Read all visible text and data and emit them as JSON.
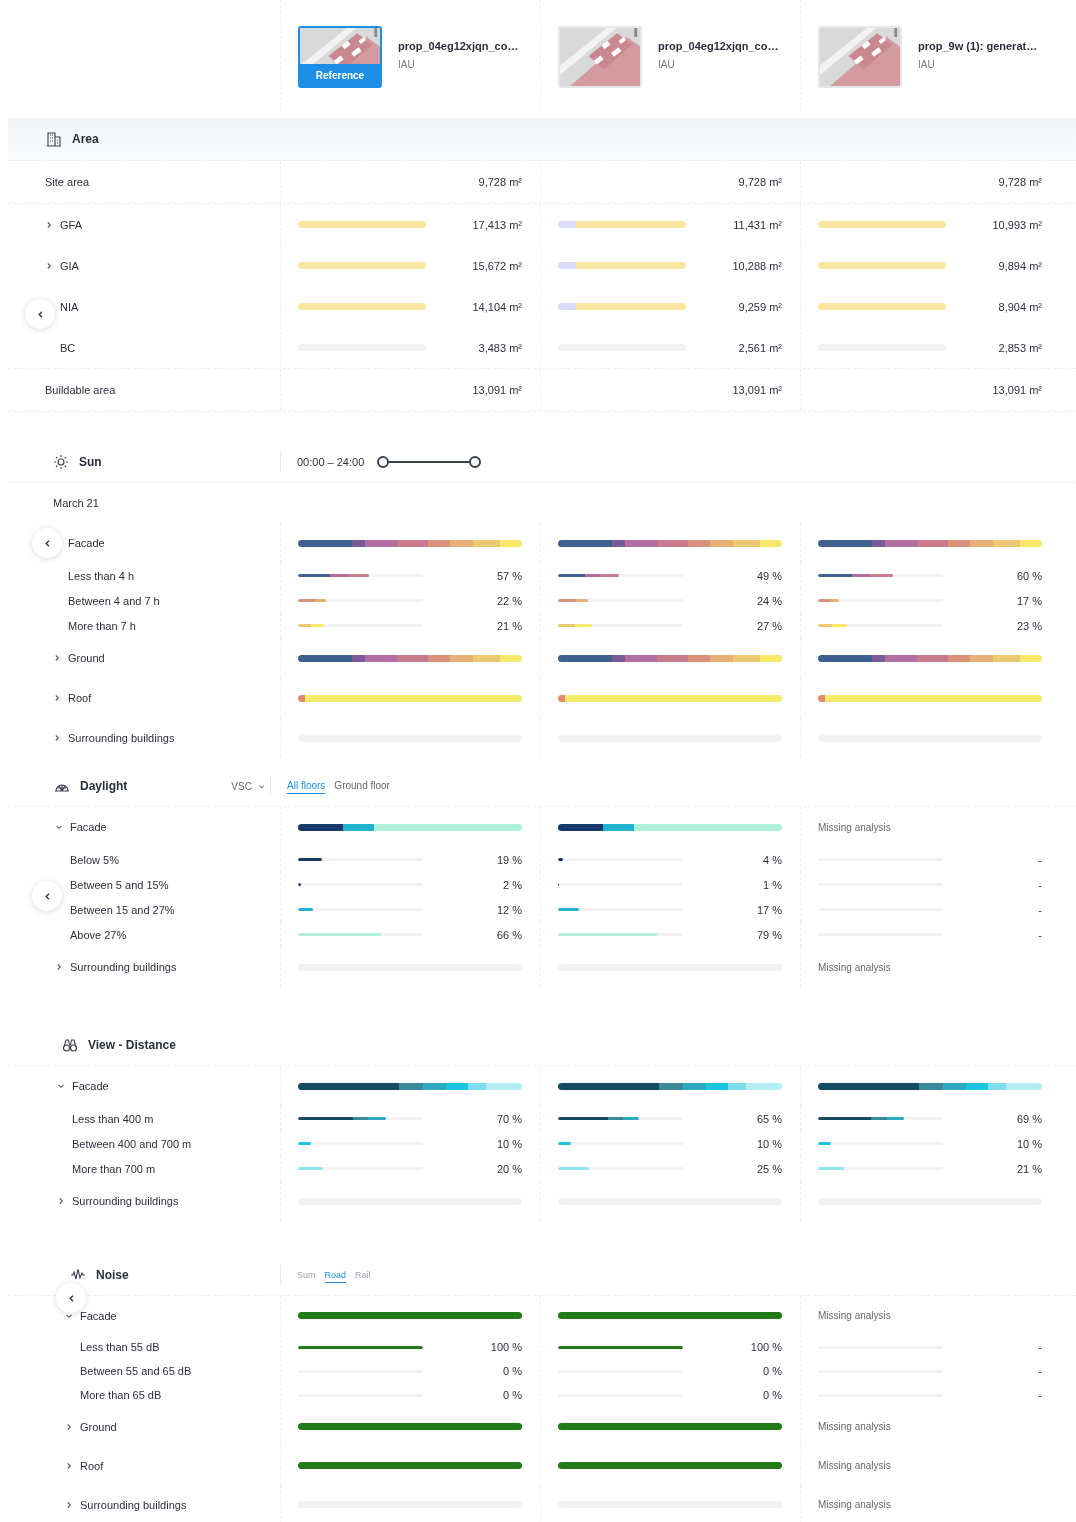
{
  "proposals": [
    {
      "name": "prop_04eg12xjqn_co…",
      "owner": "IAU",
      "reference": true,
      "badge": "Reference"
    },
    {
      "name": "prop_04eg12xjqn_co…",
      "owner": "IAU",
      "reference": false
    },
    {
      "name": "prop_9w (1): generat…",
      "owner": "IAU",
      "reference": false
    }
  ],
  "sections": [
    {
      "kind": "area",
      "title": "Area",
      "rows": [
        {
          "kind": "total",
          "label": "Site area",
          "cells": [
            {
              "kind": "text",
              "value": "9,728 m²"
            },
            {
              "kind": "text",
              "value": "9,728 m²"
            },
            {
              "kind": "text",
              "value": "9,728 m²"
            }
          ]
        },
        {
          "kind": "group",
          "label": "GFA",
          "expanded": false,
          "cells": [
            {
              "kind": "full",
              "value": "17,413 m²"
            },
            {
              "kind": "compare",
              "value": "11,431 m²"
            },
            {
              "kind": "full",
              "value": "10,993 m²"
            }
          ]
        },
        {
          "kind": "group",
          "label": "GIA",
          "expanded": false,
          "cells": [
            {
              "kind": "full",
              "value": "15,672 m²"
            },
            {
              "kind": "compare",
              "value": "10,288 m²"
            },
            {
              "kind": "full",
              "value": "9,894 m²"
            }
          ]
        },
        {
          "kind": "group",
          "label": "NIA",
          "cells": [
            {
              "kind": "full",
              "value": "14,104 m²"
            },
            {
              "kind": "compare",
              "value": "9,259 m²"
            },
            {
              "kind": "full",
              "value": "8,904 m²"
            }
          ]
        },
        {
          "kind": "group",
          "label": "BC",
          "cells": [
            {
              "kind": "empty",
              "value": "3,483 m²"
            },
            {
              "kind": "empty",
              "value": "2,561 m²"
            },
            {
              "kind": "empty",
              "value": "2,853 m²"
            }
          ]
        },
        {
          "kind": "total",
          "label": "Buildable area",
          "cells": [
            {
              "kind": "text",
              "value": "13,091 m²"
            },
            {
              "kind": "text",
              "value": "13,091 m²"
            },
            {
              "kind": "text",
              "value": "13,091 m²"
            }
          ]
        }
      ]
    },
    {
      "kind": "sun",
      "title": "Sun",
      "time_range": "00:00 – 24:00",
      "slider": {
        "level": 1
      },
      "subtitle": "March 21",
      "rows": [
        {
          "kind": "group",
          "label": "Facade",
          "cells": [
            {
              "kind": "spectrum"
            },
            {
              "kind": "spectrum"
            },
            {
              "kind": "spectrum"
            }
          ]
        },
        {
          "kind": "item",
          "label": "Less than 4 h",
          "cells": [
            {
              "kind": "level",
              "level": 0.57,
              "value": "57 %"
            },
            {
              "kind": "level",
              "level": 0.49,
              "value": "49 %"
            },
            {
              "kind": "level",
              "level": 0.6,
              "value": "60 %"
            }
          ]
        },
        {
          "kind": "item",
          "label": "Between 4 and 7 h",
          "cells": [
            {
              "kind": "level",
              "level": 0.22,
              "value": "22 %"
            },
            {
              "kind": "level",
              "level": 0.24,
              "value": "24 %"
            },
            {
              "kind": "level",
              "level": 0.17,
              "value": "17 %"
            }
          ]
        },
        {
          "kind": "item",
          "label": "More than 7 h",
          "cells": [
            {
              "kind": "level",
              "level": 0.21,
              "value": "21 %"
            },
            {
              "kind": "level",
              "level": 0.27,
              "value": "27 %"
            },
            {
              "kind": "level",
              "level": 0.23,
              "value": "23 %"
            }
          ]
        },
        {
          "kind": "group",
          "label": "Ground",
          "expanded": false,
          "cells": [
            {
              "kind": "spectrum"
            },
            {
              "kind": "spectrum"
            },
            {
              "kind": "spectrum"
            }
          ]
        },
        {
          "kind": "group",
          "label": "Roof",
          "expanded": false,
          "cells": [
            {
              "kind": "sunlit"
            },
            {
              "kind": "sunlit"
            },
            {
              "kind": "sunlit"
            }
          ]
        },
        {
          "kind": "group",
          "label": "Surrounding buildings",
          "expanded": false,
          "cells": [
            {
              "kind": "empty"
            },
            {
              "kind": "empty"
            },
            {
              "kind": "empty"
            }
          ]
        }
      ]
    },
    {
      "kind": "daylight",
      "title": "Daylight",
      "dropdown": "VSC",
      "tabs": [
        {
          "label": "All floors",
          "selected": true
        },
        {
          "label": "Ground floor",
          "selected": false
        }
      ],
      "rows": [
        {
          "kind": "group",
          "label": "Facade",
          "expanded": true,
          "cells": [
            {
              "kind": "spectrum"
            },
            {
              "kind": "spectrum"
            },
            {
              "kind": "note",
              "value": "Missing analysis"
            }
          ]
        },
        {
          "kind": "item",
          "label": "Below 5%",
          "cells": [
            {
              "kind": "level",
              "level": 0.19,
              "value": "19 %"
            },
            {
              "kind": "level",
              "level": 0.04,
              "value": "4 %"
            },
            {
              "kind": "level",
              "level": 0,
              "value": "-"
            }
          ]
        },
        {
          "kind": "item",
          "label": "Between 5 and 15%",
          "cells": [
            {
              "kind": "level",
              "level": 0.02,
              "value": "2 %"
            },
            {
              "kind": "level",
              "level": 0.01,
              "value": "1 %"
            },
            {
              "kind": "level",
              "level": 0,
              "value": "-"
            }
          ]
        },
        {
          "kind": "item",
          "label": "Between 15 and 27%",
          "cells": [
            {
              "kind": "level",
              "level": 0.12,
              "value": "12 %"
            },
            {
              "kind": "level",
              "level": 0.17,
              "value": "17 %"
            },
            {
              "kind": "level",
              "level": 0,
              "value": "-"
            }
          ]
        },
        {
          "kind": "item",
          "label": "Above 27%",
          "cells": [
            {
              "kind": "level",
              "level": 0.66,
              "value": "66 %"
            },
            {
              "kind": "level",
              "level": 0.79,
              "value": "79 %"
            },
            {
              "kind": "level",
              "level": 0,
              "value": "-"
            }
          ]
        },
        {
          "kind": "group",
          "label": "Surrounding buildings",
          "expanded": false,
          "cells": [
            {
              "kind": "empty"
            },
            {
              "kind": "empty"
            },
            {
              "kind": "note",
              "value": "Missing analysis"
            }
          ]
        }
      ]
    },
    {
      "kind": "view",
      "title": "View - Distance",
      "rows": [
        {
          "kind": "group",
          "label": "Facade",
          "expanded": true,
          "cells": [
            {
              "kind": "spectrum"
            },
            {
              "kind": "spectrum"
            },
            {
              "kind": "spectrum"
            }
          ]
        },
        {
          "kind": "item",
          "label": "Less than 400 m",
          "cells": [
            {
              "kind": "level",
              "level": 0.7,
              "value": "70 %"
            },
            {
              "kind": "level",
              "level": 0.65,
              "value": "65 %"
            },
            {
              "kind": "level",
              "level": 0.69,
              "value": "69 %"
            }
          ]
        },
        {
          "kind": "item",
          "label": "Between 400 and 700 m",
          "cells": [
            {
              "kind": "level",
              "level": 0.1,
              "value": "10 %"
            },
            {
              "kind": "level",
              "level": 0.1,
              "value": "10 %"
            },
            {
              "kind": "level",
              "level": 0.1,
              "value": "10 %"
            }
          ]
        },
        {
          "kind": "item",
          "label": "More than 700 m",
          "cells": [
            {
              "kind": "level",
              "level": 0.2,
              "value": "20 %"
            },
            {
              "kind": "level",
              "level": 0.25,
              "value": "25 %"
            },
            {
              "kind": "level",
              "level": 0.21,
              "value": "21 %"
            }
          ]
        },
        {
          "kind": "group",
          "label": "Surrounding buildings",
          "expanded": false,
          "cells": [
            {
              "kind": "empty"
            },
            {
              "kind": "empty"
            },
            {
              "kind": "empty"
            }
          ]
        }
      ]
    },
    {
      "kind": "noise",
      "title": "Noise",
      "tabs": [
        {
          "label": "Sum",
          "selected": false
        },
        {
          "label": "Road",
          "selected": true
        },
        {
          "label": "Rail",
          "selected": false
        }
      ],
      "rows": [
        {
          "kind": "group",
          "label": "Facade",
          "expanded": true,
          "cells": [
            {
              "kind": "full"
            },
            {
              "kind": "full"
            },
            {
              "kind": "note",
              "value": "Missing analysis"
            }
          ]
        },
        {
          "kind": "item",
          "label": "Less than 55 dB",
          "cells": [
            {
              "kind": "level",
              "level": 1,
              "value": "100 %"
            },
            {
              "kind": "level",
              "level": 1,
              "value": "100 %"
            },
            {
              "kind": "level",
              "level": 0,
              "value": "-"
            }
          ]
        },
        {
          "kind": "item",
          "label": "Between 55 and 65 dB",
          "cells": [
            {
              "kind": "level",
              "level": 0,
              "value": "0 %"
            },
            {
              "kind": "level",
              "level": 0,
              "value": "0 %"
            },
            {
              "kind": "level",
              "level": 0,
              "value": "-"
            }
          ]
        },
        {
          "kind": "item",
          "label": "More than 65 dB",
          "cells": [
            {
              "kind": "level",
              "level": 0,
              "value": "0 %"
            },
            {
              "kind": "level",
              "level": 0,
              "value": "0 %"
            },
            {
              "kind": "level",
              "level": 0,
              "value": "-"
            }
          ]
        },
        {
          "kind": "group",
          "label": "Ground",
          "expanded": false,
          "cells": [
            {
              "kind": "full"
            },
            {
              "kind": "full"
            },
            {
              "kind": "note",
              "value": "Missing analysis"
            }
          ]
        },
        {
          "kind": "group",
          "label": "Roof",
          "expanded": false,
          "cells": [
            {
              "kind": "full"
            },
            {
              "kind": "full"
            },
            {
              "kind": "note",
              "value": "Missing analysis"
            }
          ]
        },
        {
          "kind": "group",
          "label": "Surrounding buildings",
          "expanded": false,
          "cells": [
            {
              "kind": "empty"
            },
            {
              "kind": "empty"
            },
            {
              "kind": "note",
              "value": "Missing analysis"
            }
          ]
        }
      ]
    }
  ]
}
